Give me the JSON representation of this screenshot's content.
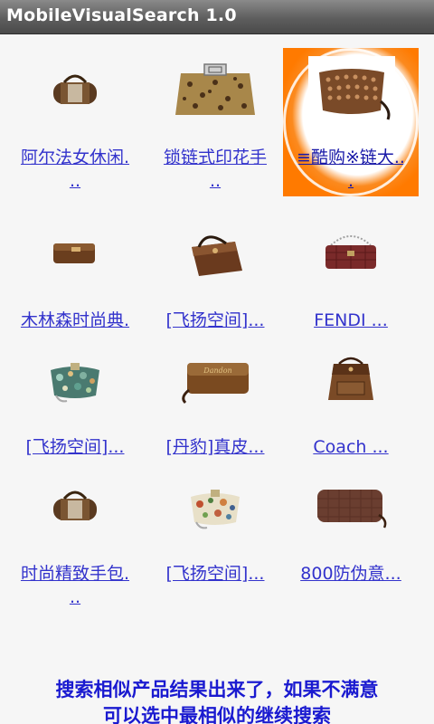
{
  "app": {
    "title": "MobileVisualSearch 1.0"
  },
  "grid": {
    "items": [
      {
        "label1": "阿尔法女休闲.",
        "label2": "..",
        "icon": "barrel-handbag-icon"
      },
      {
        "label1": "锁链式印花手",
        "label2": "..",
        "icon": "leopard-clutch-icon"
      },
      {
        "label1": "≡酷购※链大..",
        "label2": ".",
        "icon": "studded-clutch-icon"
      },
      {
        "label1": "木林森时尚典.",
        "label2": "",
        "icon": "brown-wallet-icon"
      },
      {
        "label1": "[飞扬空间]...",
        "label2": "",
        "icon": "brown-shoulder-bag-icon"
      },
      {
        "label1": "FENDI ...",
        "label2": "",
        "icon": "fendi-chain-bag-icon"
      },
      {
        "label1": "[飞扬空间]...",
        "label2": "",
        "icon": "floral-clutch-icon"
      },
      {
        "label1": "[丹豹]真皮...",
        "label2": "",
        "icon": "croc-wallet-icon"
      },
      {
        "label1": "Coach ...",
        "label2": "",
        "icon": "coach-bag-icon"
      },
      {
        "label1": "时尚精致手包.",
        "label2": "..",
        "icon": "barrel-handbag-icon"
      },
      {
        "label1": "[飞扬空间]...",
        "label2": "",
        "icon": "floral-clutch-icon"
      },
      {
        "label1": "800防伪意...",
        "label2": "",
        "icon": "check-pattern-wallet-icon"
      }
    ]
  },
  "footer": {
    "line1": "搜索相似产品结果出来了，如果不满意",
    "line2": "可以选中最相似的继续搜索"
  },
  "colors": {
    "link": "#3333cc",
    "footer": "#1a1ad0",
    "selection": "#ff7a00",
    "titlebar": "#5e5e5e"
  }
}
